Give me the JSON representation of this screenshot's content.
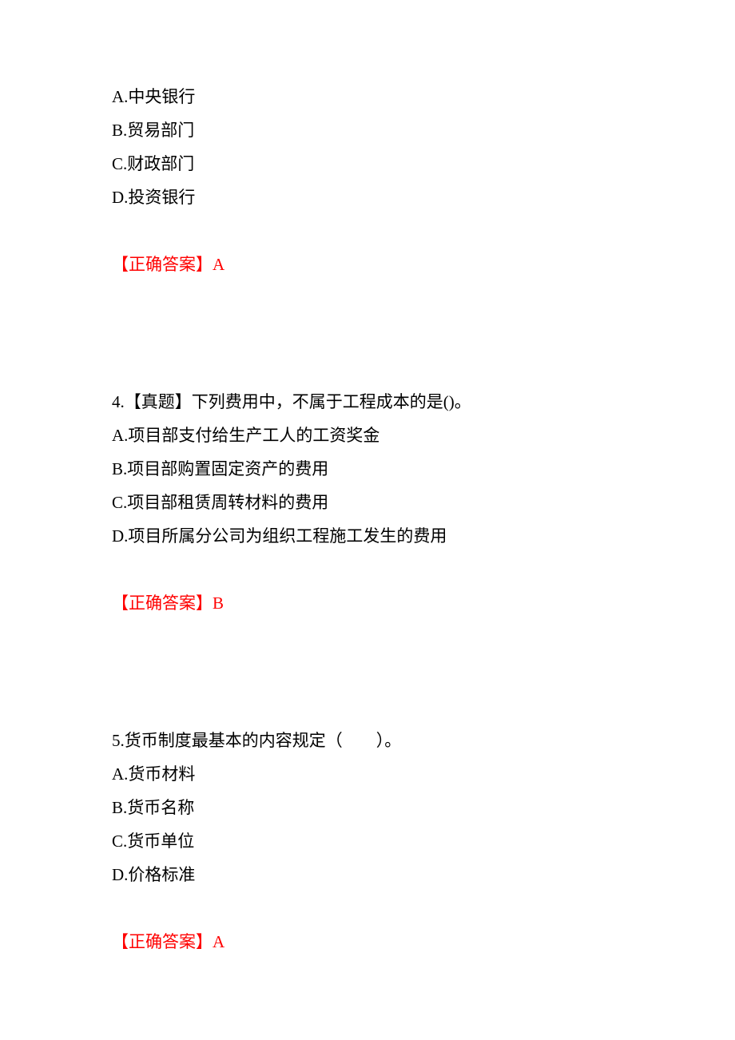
{
  "q3": {
    "choice_a": "A.中央银行",
    "choice_b": "B.贸易部门",
    "choice_c": "C.财政部门",
    "choice_d": "D.投资银行",
    "answer_label": "【正确答案】",
    "answer_value": "A"
  },
  "q4": {
    "stem": "4.【真题】下列费用中，不属于工程成本的是()。",
    "choice_a": "A.项目部支付给生产工人的工资奖金",
    "choice_b": "B.项目部购置固定资产的费用",
    "choice_c": "C.项目部租赁周转材料的费用",
    "choice_d": "D.项目所属分公司为组织工程施工发生的费用",
    "answer_label": "【正确答案】",
    "answer_value": "B"
  },
  "q5": {
    "stem": "5.货币制度最基本的内容规定（　　）。",
    "choice_a": "A.货币材料",
    "choice_b": "B.货币名称",
    "choice_c": "C.货币单位",
    "choice_d": "D.价格标准",
    "answer_label": "【正确答案】",
    "answer_value": "A"
  }
}
